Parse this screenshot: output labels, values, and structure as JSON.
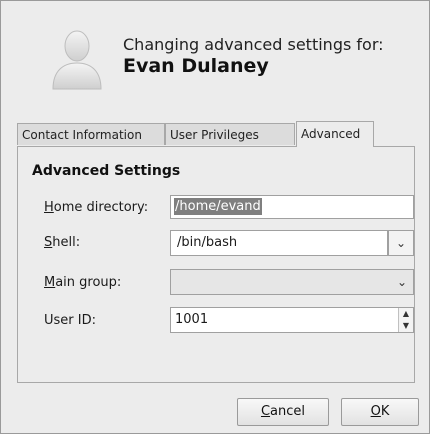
{
  "header": {
    "line1": "Changing advanced settings for:",
    "user_name": "Evan Dulaney",
    "avatar_icon": "user-silhouette-icon"
  },
  "tabs": [
    {
      "label": "Contact Information",
      "active": false
    },
    {
      "label": "User Privileges",
      "active": false
    },
    {
      "label": "Advanced",
      "active": true
    }
  ],
  "section": {
    "title": "Advanced Settings",
    "home": {
      "label_mnemonic": "H",
      "label_rest": "ome directory:",
      "value": "/home/evand"
    },
    "shell": {
      "label_mnemonic": "S",
      "label_rest": "hell:",
      "value": "/bin/bash"
    },
    "group": {
      "label_mnemonic": "M",
      "label_rest": "ain group:",
      "value": ""
    },
    "userid": {
      "label": "User ID:",
      "value": "1001"
    }
  },
  "buttons": {
    "cancel_mnemonic": "C",
    "cancel_rest": "ancel",
    "ok_mnemonic": "O",
    "ok_rest": "K"
  },
  "colors": {
    "selection": "#7f7f7f",
    "background": "#ececec"
  }
}
